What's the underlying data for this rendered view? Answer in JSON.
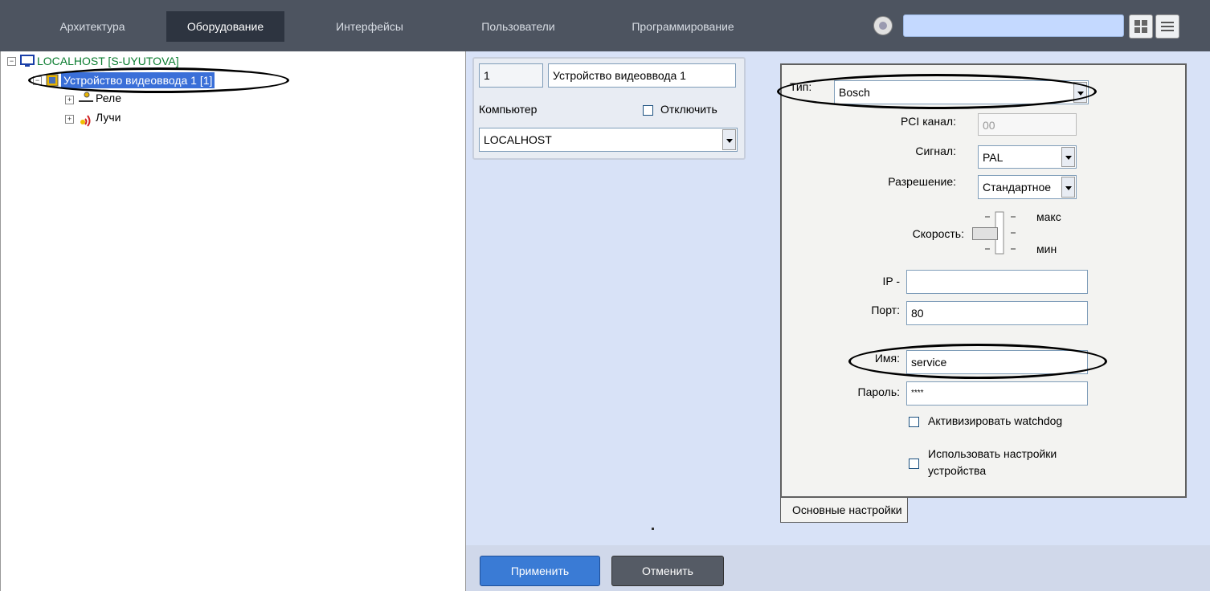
{
  "top_tabs": [
    {
      "label": "Архитектура"
    },
    {
      "label": "Оборудование"
    },
    {
      "label": "Интерфейсы"
    },
    {
      "label": "Пользователи"
    },
    {
      "label": "Программирование"
    }
  ],
  "active_tab": "Оборудование",
  "tree": {
    "root": "LOCALHOST [S-UYUTOVA]",
    "device": "Устройство видеоввода 1 [1]",
    "children": [
      "Реле",
      "Лучи"
    ]
  },
  "general": {
    "id": "1",
    "name": "Устройство видеоввода 1",
    "computer_label": "Компьютер",
    "disable_label": "Отключить",
    "computer_value": "LOCALHOST"
  },
  "device": {
    "type_label": "Тип:",
    "type_value": "Bosch",
    "pci_label": "PCI канал:",
    "pci_value": "00",
    "signal_label": "Сигнал:",
    "signal_value": "PAL",
    "resolution_label": "Разрешение:",
    "resolution_value": "Стандартное",
    "speed_label": "Скорость:",
    "speed_max": "макс",
    "speed_min": "мин",
    "ip_label": "IP -",
    "ip_value": "",
    "port_label": "Порт:",
    "port_value": "80",
    "name_label": "Имя:",
    "name_value": "service",
    "password_label": "Пароль:",
    "password_value": "****",
    "watchdog_label": "Активизировать watchdog",
    "use_settings_label_1": "Использовать настройки",
    "use_settings_label_2": "устройства"
  },
  "panel_tab": "Основные настройки",
  "buttons": {
    "apply": "Применить",
    "cancel": "Отменить"
  },
  "colors": {
    "topbar": "#4d5460",
    "active_tab": "#2d3440",
    "apply": "#3a7bd5",
    "cancel": "#555b65",
    "settings_bg": "#d8e2f7",
    "tree_root_text": "#0a7c2f"
  },
  "icons": [
    "gear-icon",
    "grid-icon",
    "menu-icon",
    "monitor-icon",
    "chip-icon",
    "relay-icon",
    "ray-icon"
  ]
}
